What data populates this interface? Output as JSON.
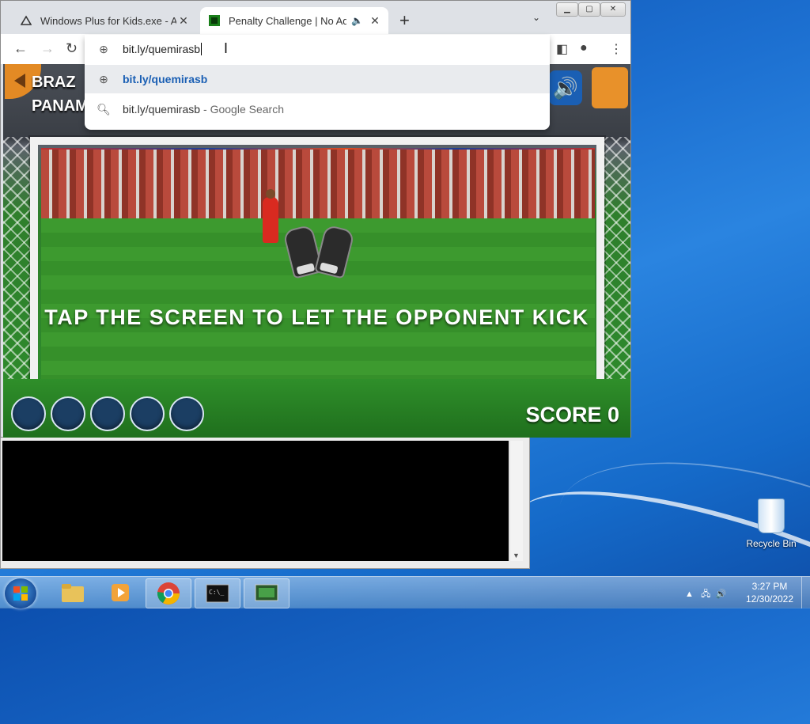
{
  "browser": {
    "tabs": [
      {
        "title": "Windows Plus for Kids.exe - Anon",
        "active": false
      },
      {
        "title": "Penalty Challenge | No Ads |",
        "active": true
      }
    ],
    "omnibox": {
      "input_value": "bit.ly/quemirasb",
      "suggestions": [
        {
          "text": "bit.ly/quemirasb",
          "secondary": "",
          "icon": "globe-icon"
        },
        {
          "text": "bit.ly/quemirasb",
          "secondary": "- Google Search",
          "icon": "search-icon"
        }
      ]
    }
  },
  "game": {
    "team_top": "BRAZ",
    "team_bottom": "PANAM",
    "instruction": "TAP THE SCREEN TO LET THE OPPONENT KICK",
    "score_label": "SCORE 0",
    "shots": 5
  },
  "desktop": {
    "recycle_bin_label": "Recycle Bin"
  },
  "taskbar": {
    "time": "3:27 PM",
    "date": "12/30/2022"
  },
  "colors": {
    "accent_link": "#1a5fb4",
    "desktop_blue": "#1c6fd0",
    "pitch_green": "#2c8d2b"
  }
}
